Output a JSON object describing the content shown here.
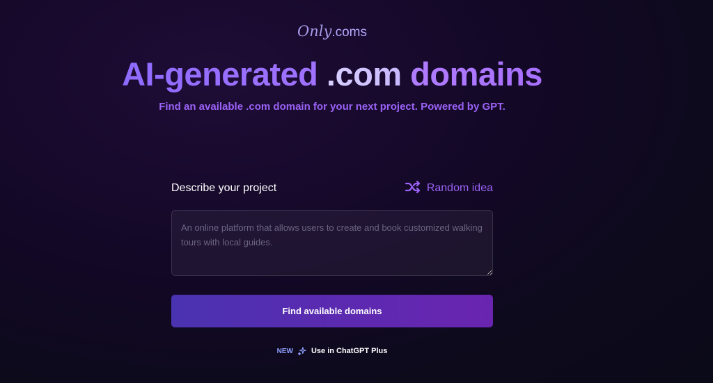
{
  "logo": {
    "script": "Only",
    "suffix": ".coms"
  },
  "hero": {
    "title_part_a": "AI-generated",
    "title_part_b": ".com",
    "title_part_c": "domains",
    "subtitle": "Find an available .com domain for your next project. Powered by GPT."
  },
  "form": {
    "label": "Describe your project",
    "random_label": "Random idea",
    "random_icon": "shuffle-icon",
    "textarea_value": "",
    "textarea_placeholder": "An online platform that allows users to create and book customized walking tours with local guides.",
    "submit_label": "Find available domains"
  },
  "chatgpt": {
    "badge": "NEW",
    "icon": "sparkle-icon",
    "link_label": "Use in ChatGPT Plus"
  },
  "colors": {
    "accent": "#9a62f6",
    "background": "#130826",
    "button_start": "#4a33b0",
    "button_end": "#6a25b0"
  }
}
